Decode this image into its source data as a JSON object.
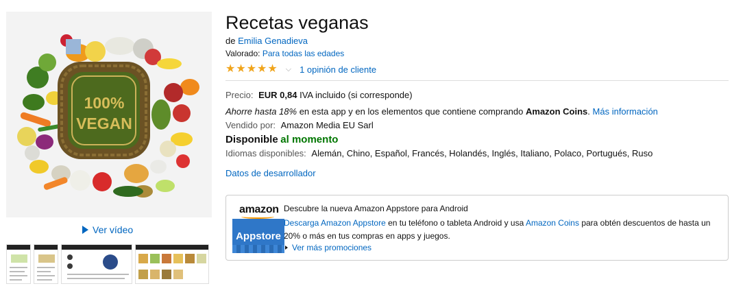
{
  "product": {
    "title": "Recetas veganas",
    "by_prefix": "de",
    "author": "Emilia Genadieva",
    "rated_prefix": "Valorado:",
    "rated_value": "Para todas las edades",
    "stars": 5,
    "reviews_label": "1 opinión de cliente"
  },
  "image": {
    "badge_line1": "100%",
    "badge_line2": "VEGAN",
    "video_label": "Ver vídeo"
  },
  "price": {
    "label": "Precio:",
    "value": "EUR 0,84",
    "note": "IVA incluido (si corresponde)"
  },
  "coins": {
    "prefix": "Ahorre hasta 18%",
    "middle": "en esta app y en los elementos que contiene comprando",
    "brand": "Amazon Coins",
    "more": "Más información"
  },
  "seller": {
    "label": "Vendido por:",
    "value": "Amazon Media EU Sarl"
  },
  "availability": {
    "label": "Disponible",
    "value": "al momento"
  },
  "languages": {
    "label": "Idiomas disponibles:",
    "value": "Alemán, Chino, Español, Francés, Holandés, Inglés, Italiano, Polaco, Portugués, Ruso"
  },
  "developer_link": "Datos de desarrollador",
  "appstore_box": {
    "logo_text": "amazon",
    "badge_text": "Appstore",
    "headline": "Descubre la nueva Amazon Appstore para Android",
    "link1": "Descarga Amazon Appstore",
    "text1": "en tu teléfono o tableta Android y usa",
    "link2": "Amazon Coins",
    "text2": "para obtén descuentos de hasta un 20% o más en tus compras en apps y juegos.",
    "more": "Ver más promociones"
  },
  "colors": {
    "link": "#0066c0",
    "star": "#f0a41b",
    "available": "#007600",
    "appstore_badge": "#2f77c8"
  }
}
